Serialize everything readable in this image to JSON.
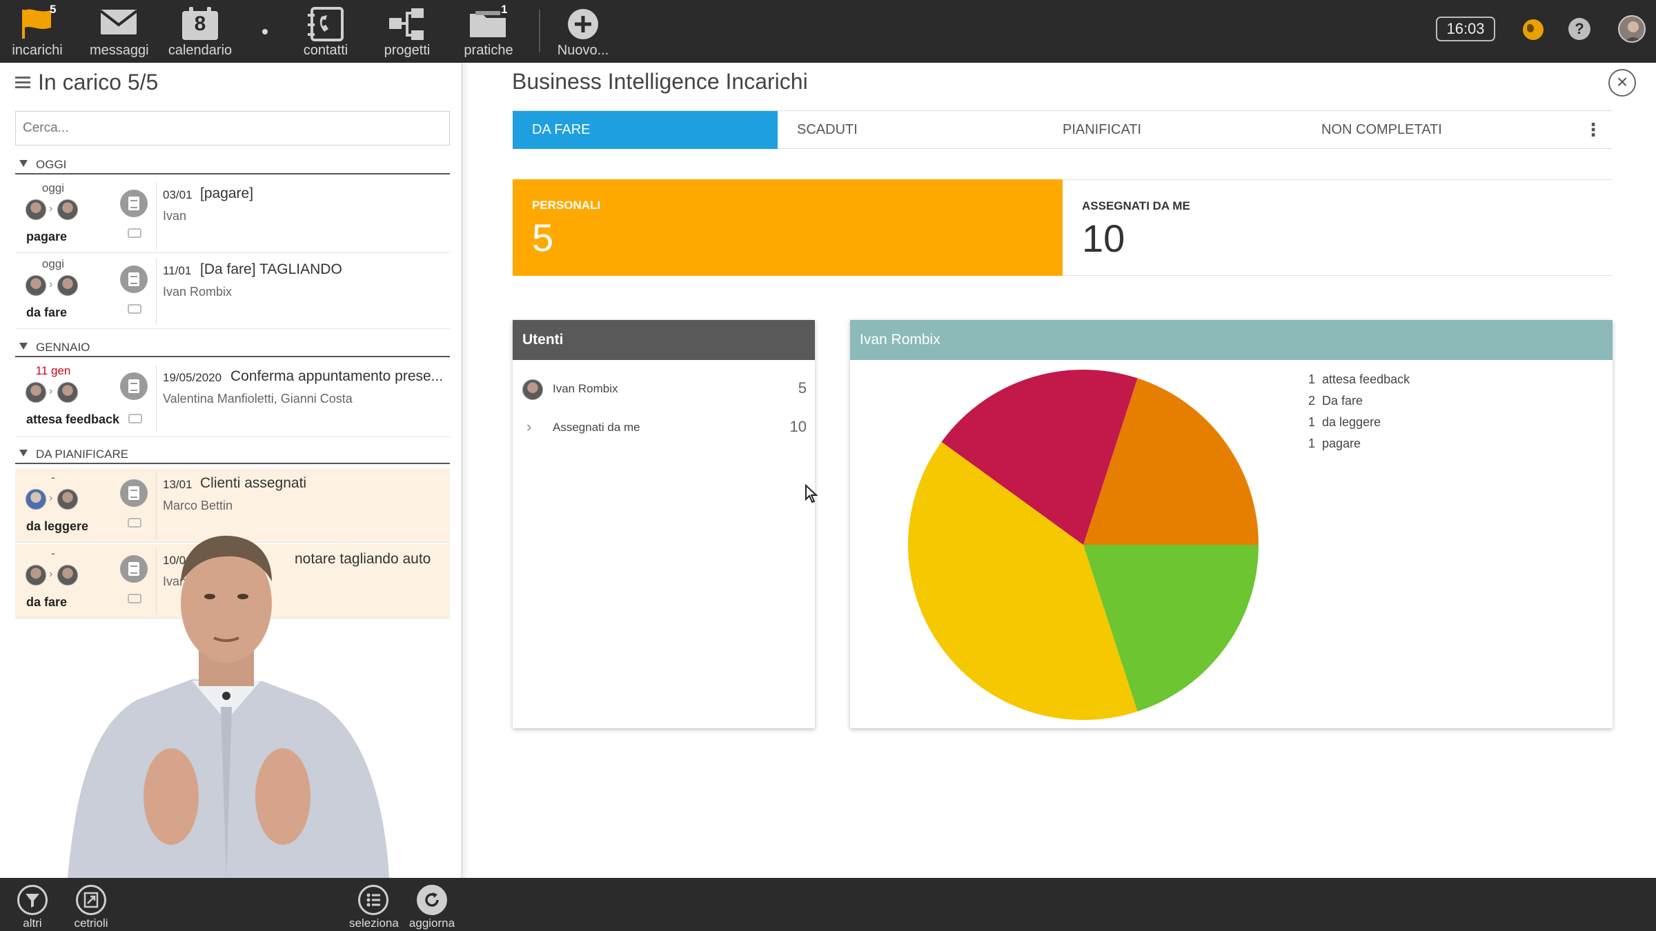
{
  "topnav": {
    "items": [
      {
        "label": "incarichi",
        "badge": "5"
      },
      {
        "label": "messaggi"
      },
      {
        "label": "calendario",
        "day": "8"
      },
      {
        "label": "contatti"
      },
      {
        "label": "progetti"
      },
      {
        "label": "pratiche",
        "badge": "1"
      },
      {
        "label": "Nuovo..."
      }
    ],
    "clock": "16:03",
    "help": "?"
  },
  "left": {
    "title": "In carico 5/5",
    "search_placeholder": "Cerca...",
    "groups": [
      {
        "label": "OGGI",
        "tasks": [
          {
            "when": "oggi",
            "status": "pagare",
            "date": "03/01",
            "title": "[pagare]",
            "who": "Ivan"
          },
          {
            "when": "oggi",
            "status": "da fare",
            "date": "11/01",
            "title": "[Da fare] TAGLIANDO",
            "who": "Ivan Rombix"
          }
        ]
      },
      {
        "label": "GENNAIO",
        "tasks": [
          {
            "when": "11 gen",
            "status": "attesa feedback",
            "date": "19/05/2020",
            "title": "Conferma appuntamento prese...",
            "who": "Valentina Manfioletti, Gianni Costa"
          }
        ]
      },
      {
        "label": "DA PIANIFICARE",
        "tasks": [
          {
            "when": "-",
            "status": "da leggere",
            "date": "13/01",
            "title": "Clienti assegnati",
            "who": "Marco Bettin"
          },
          {
            "when": "-",
            "status": "da fare",
            "date": "10/01",
            "title": "notare tagliando auto",
            "who": "Ivan"
          }
        ]
      }
    ]
  },
  "main": {
    "title": "Business Intelligence Incarichi",
    "tabs": [
      "DA FARE",
      "SCADUTI",
      "PIANIFICATI",
      "NON COMPLETATI"
    ],
    "kpis": [
      {
        "label": "PERSONALI",
        "value": "5"
      },
      {
        "label": "ASSEGNATI DA ME",
        "value": "10"
      }
    ],
    "users_card": {
      "title": "Utenti",
      "rows": [
        {
          "name": "Ivan Rombix",
          "count": "5"
        },
        {
          "name": "Assegnati da me",
          "count": "10"
        }
      ]
    },
    "pie_card": {
      "title": "Ivan Rombix"
    }
  },
  "chart_data": {
    "type": "pie",
    "title": "Ivan Rombix",
    "slices": [
      {
        "label": "attesa feedback",
        "value": 1,
        "color": "#e67e00"
      },
      {
        "label": "Da fare",
        "value": 2,
        "color": "#f5c800"
      },
      {
        "label": "da leggere",
        "value": 1,
        "color": "#c2184a"
      },
      {
        "label": "pagare",
        "value": 1,
        "color": "#6cc531"
      }
    ],
    "legend_position": "right"
  },
  "colors": {
    "accent_tab": "#1e9fe0",
    "kpi_personal": "#ffa900",
    "users_header": "#595959",
    "pie_header": "#8bbab8",
    "highlight_row": "#fdf1e1"
  },
  "bottombar": {
    "items": [
      "altri",
      "cetrioli",
      "seleziona",
      "aggiorna"
    ]
  }
}
